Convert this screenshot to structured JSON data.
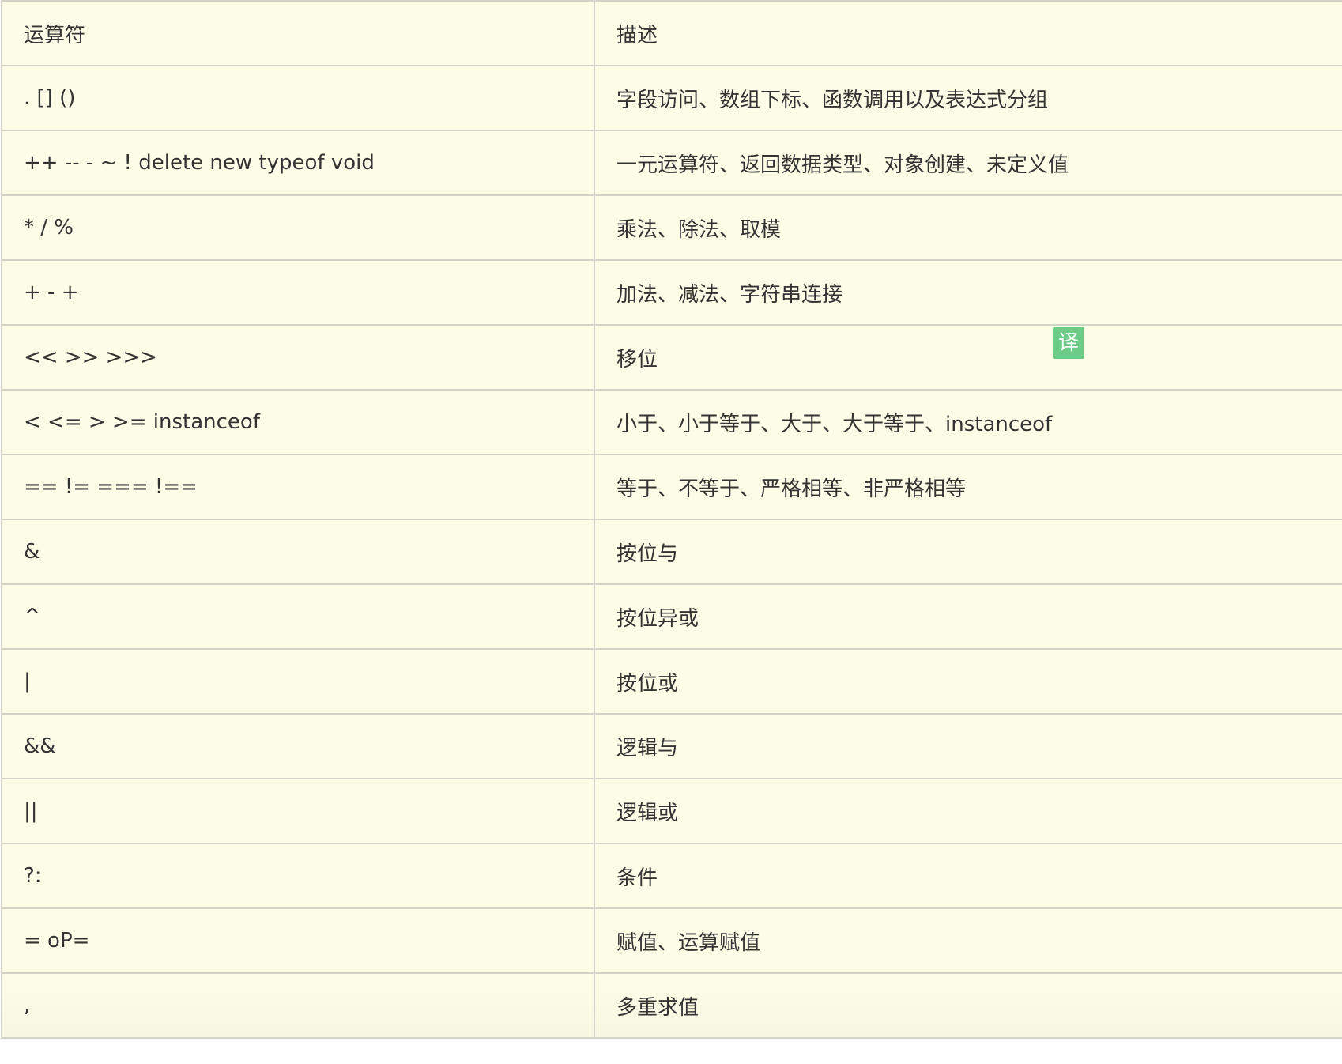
{
  "table": {
    "headers": [
      "运算符",
      "描述"
    ],
    "rows": [
      {
        "op": ". [] ()",
        "desc": "字段访问、数组下标、函数调用以及表达式分组"
      },
      {
        "op": "++ -- - ~ ! delete new typeof void",
        "desc": "一元运算符、返回数据类型、对象创建、未定义值"
      },
      {
        "op": "* / %",
        "desc": "乘法、除法、取模"
      },
      {
        "op": "+ - +",
        "desc": "加法、减法、字符串连接"
      },
      {
        "op": "<< >> >>>",
        "desc": "移位"
      },
      {
        "op": "< <= > >= instanceof",
        "desc": "小于、小于等于、大于、大于等于、instanceof"
      },
      {
        "op": "== != === !==",
        "desc": "等于、不等于、严格相等、非严格相等"
      },
      {
        "op": "&",
        "desc": "按位与"
      },
      {
        "op": "^",
        "desc": "按位异或"
      },
      {
        "op": "|",
        "desc": "按位或"
      },
      {
        "op": "&&",
        "desc": "逻辑与"
      },
      {
        "op": "||",
        "desc": "逻辑或"
      },
      {
        "op": "?:",
        "desc": "条件"
      },
      {
        "op": "= oP=",
        "desc": "赋值、运算赋值"
      },
      {
        "op": ",",
        "desc": "多重求值"
      }
    ]
  },
  "translate_badge": {
    "label": "译",
    "color": "#6ccb86"
  },
  "colors": {
    "background": "#fdfde7",
    "border": "#d3d3c8",
    "text": "#333333"
  }
}
